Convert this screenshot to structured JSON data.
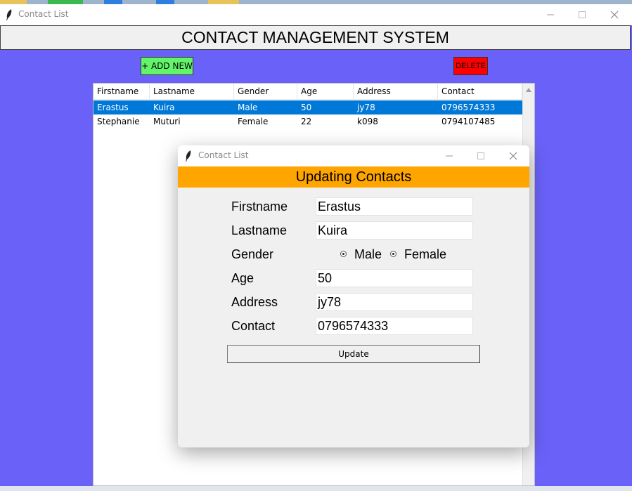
{
  "main_window": {
    "title": "Contact List",
    "header": "CONTACT MANAGEMENT SYSTEM",
    "add_label": "+ ADD NEW",
    "delete_label": "DELETE",
    "colors": {
      "background": "#6a62f8",
      "add": "#62f56a",
      "delete": "#ff0000",
      "selection": "#0078d7"
    }
  },
  "table": {
    "columns": [
      "Firstname",
      "Lastname",
      "Gender",
      "Age",
      "Address",
      "Contact"
    ],
    "rows": [
      [
        "Erastus",
        "Kuira",
        "Male",
        "50",
        "jy78",
        "0796574333"
      ],
      [
        "Stephanie",
        "Muturi",
        "Female",
        "22",
        "k098",
        "0794107485"
      ]
    ],
    "selected_row": 0
  },
  "dialog": {
    "title": "Contact List",
    "heading": "Updating Contacts",
    "labels": {
      "firstname": "Firstname",
      "lastname": "Lastname",
      "gender": "Gender",
      "age": "Age",
      "address": "Address",
      "contact": "Contact"
    },
    "values": {
      "firstname": "Erastus",
      "lastname": "Kuira",
      "age": "50",
      "address": "jy78",
      "contact": "0796574333"
    },
    "gender_options": [
      "Male",
      "Female"
    ],
    "update_label": "Update",
    "colors": {
      "band": "#ffa500"
    }
  },
  "window_controls": {
    "minimize": "minimize-icon",
    "maximize": "maximize-icon",
    "close": "close-icon"
  }
}
